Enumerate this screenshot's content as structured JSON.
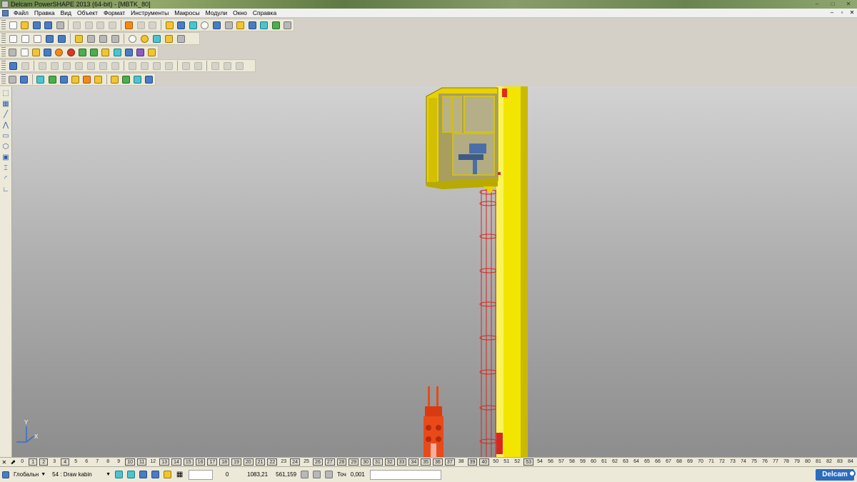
{
  "window": {
    "title": "Delcam PowerSHAPE 2013 (64-bit) - [MBTK_80]",
    "controls": [
      "–",
      "□",
      "✕"
    ]
  },
  "menu": {
    "items": [
      "Файл",
      "Правка",
      "Вид",
      "Объект",
      "Формат",
      "Инструменты",
      "Макросы",
      "Модули",
      "Окно",
      "Справка"
    ],
    "mdi_controls": [
      "–",
      "▫",
      "✕"
    ]
  },
  "viewport": {
    "axis_labels": {
      "x": "X",
      "y": "Y"
    }
  },
  "levels": {
    "items": [
      {
        "n": "0",
        "on": false
      },
      {
        "n": "1",
        "on": true
      },
      {
        "n": "2",
        "on": true
      },
      {
        "n": "3",
        "on": false
      },
      {
        "n": "4",
        "on": true
      },
      {
        "n": "5",
        "on": false
      },
      {
        "n": "6",
        "on": false
      },
      {
        "n": "7",
        "on": false
      },
      {
        "n": "8",
        "on": false
      },
      {
        "n": "9",
        "on": false
      },
      {
        "n": "10",
        "on": true
      },
      {
        "n": "11",
        "on": true
      },
      {
        "n": "12",
        "on": false
      },
      {
        "n": "13",
        "on": true
      },
      {
        "n": "14",
        "on": true
      },
      {
        "n": "15",
        "on": true
      },
      {
        "n": "16",
        "on": true
      },
      {
        "n": "17",
        "on": true
      },
      {
        "n": "18",
        "on": true
      },
      {
        "n": "19",
        "on": true
      },
      {
        "n": "20",
        "on": true
      },
      {
        "n": "21",
        "on": true
      },
      {
        "n": "22",
        "on": true
      },
      {
        "n": "23",
        "on": false
      },
      {
        "n": "24",
        "on": true
      },
      {
        "n": "25",
        "on": false
      },
      {
        "n": "26",
        "on": true
      },
      {
        "n": "27",
        "on": true
      },
      {
        "n": "28",
        "on": true
      },
      {
        "n": "29",
        "on": true
      },
      {
        "n": "30",
        "on": true
      },
      {
        "n": "31",
        "on": true
      },
      {
        "n": "32",
        "on": true
      },
      {
        "n": "33",
        "on": true
      },
      {
        "n": "34",
        "on": true
      },
      {
        "n": "35",
        "on": true
      },
      {
        "n": "36",
        "on": true
      },
      {
        "n": "37",
        "on": true
      },
      {
        "n": "38",
        "on": false
      },
      {
        "n": "39",
        "on": true
      },
      {
        "n": "40",
        "on": true
      },
      {
        "n": "50",
        "on": false
      },
      {
        "n": "51",
        "on": false
      },
      {
        "n": "52",
        "on": false
      },
      {
        "n": "53",
        "on": true
      },
      {
        "n": "54",
        "on": false
      },
      {
        "n": "56",
        "on": false
      },
      {
        "n": "57",
        "on": false
      },
      {
        "n": "58",
        "on": false
      },
      {
        "n": "59",
        "on": false
      },
      {
        "n": "60",
        "on": false
      },
      {
        "n": "61",
        "on": false
      },
      {
        "n": "62",
        "on": false
      },
      {
        "n": "63",
        "on": false
      },
      {
        "n": "64",
        "on": false
      },
      {
        "n": "65",
        "on": false
      },
      {
        "n": "66",
        "on": false
      },
      {
        "n": "67",
        "on": false
      },
      {
        "n": "68",
        "on": false
      },
      {
        "n": "69",
        "on": false
      },
      {
        "n": "70",
        "on": false
      },
      {
        "n": "71",
        "on": false
      },
      {
        "n": "72",
        "on": false
      },
      {
        "n": "73",
        "on": false
      },
      {
        "n": "74",
        "on": false
      },
      {
        "n": "75",
        "on": false
      },
      {
        "n": "76",
        "on": false
      },
      {
        "n": "77",
        "on": false
      },
      {
        "n": "78",
        "on": false
      },
      {
        "n": "79",
        "on": false
      },
      {
        "n": "80",
        "on": false
      },
      {
        "n": "81",
        "on": false
      },
      {
        "n": "82",
        "on": false
      },
      {
        "n": "83",
        "on": false
      },
      {
        "n": "84",
        "on": false
      }
    ]
  },
  "status": {
    "workplane": "Глобальн",
    "level": "54 : Draw kabin",
    "value0": "0",
    "coord_x": "1083,21",
    "coord_y": "561,159",
    "tolerance_label": "Точ",
    "tolerance_value": "0,001",
    "brand": "Delcam"
  },
  "colors": {
    "column_yellow": "#f2e600",
    "cabin_yellow": "#e8d200",
    "ladder_red": "#d8281e",
    "hook_orange": "#e84a1a"
  }
}
